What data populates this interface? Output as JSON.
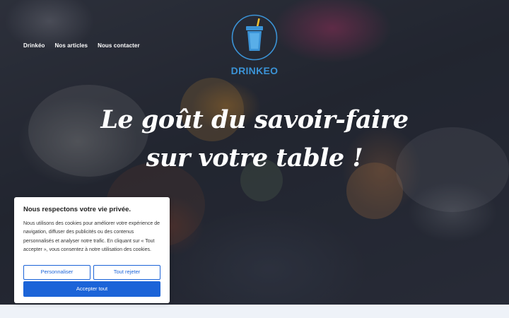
{
  "nav": {
    "items": [
      {
        "label": "Drinkéo"
      },
      {
        "label": "Nos articles"
      },
      {
        "label": "Nous contacter"
      }
    ]
  },
  "logo": {
    "text": "DRINKEO",
    "icon": "cup-with-straw-icon",
    "accent_color": "#3b93d6"
  },
  "hero": {
    "headline_line1": "Le goût du savoir-faire",
    "headline_line2": "sur votre table !"
  },
  "cookie_banner": {
    "title": "Nous respectons votre vie privée.",
    "body": "Nous utilisons des cookies pour améliorer votre expérience de navigation, diffuser des publicités ou des contenus personnalisés et analyser notre trafic. En cliquant sur « Tout accepter », vous consentez à notre utilisation des cookies.",
    "customize_label": "Personnaliser",
    "reject_label": "Tout rejeter",
    "accept_label": "Accepter tout",
    "button_color": "#1c64d8"
  }
}
